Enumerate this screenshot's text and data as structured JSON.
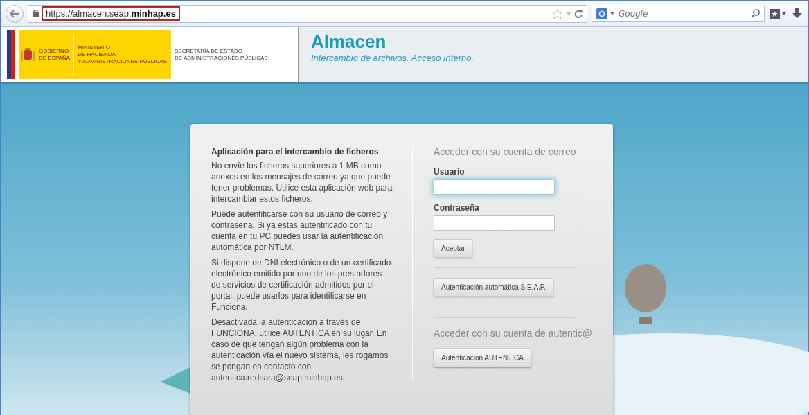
{
  "browser": {
    "url": "https://almacen.seap.**minhap.es**",
    "search": {
      "placeholder": "Google"
    }
  },
  "header": {
    "logo": {
      "gov": [
        "GOBIERNO",
        "DE ESPAÑA"
      ],
      "ministry": [
        "MINISTERIO",
        "DE HACIENDA",
        "Y ADMINISTRACIONES PÚBLICAS"
      ],
      "secretary": [
        "SECRETARÍA DE ESTADO",
        "DE ADMINISTRACIONES PÚBLICAS"
      ]
    },
    "title": "Almacen",
    "subtitle": "Intercambio de archivos. Acceso Interno."
  },
  "info": {
    "heading": "Aplicación para el intercambio de ficheros",
    "paragraphs": [
      "No envíe los ficheros superiores a 1 MB como anexos en los mensajes de correo ya que puede tener problemas. Utilice esta aplicación web para intercambiar estos ficheros.",
      "Puede autentificarse con su usuario de correo y contraseña. Si ya estas autentificado con tu cuenta en tu PC puedes usar la autentificación automática por NTLM.",
      "Si dispone de DNI electrónico o de un certificado electrónico emitido por uno de los prestadores de servicios de certificación admitidos por el portal, puede usarlos para identificarse en Funciona.",
      "Desactivada la autenticación a través de FUNCIONA, utilice AUTENTICA en su lugar. En caso de que tengan algún problema con la autenticación vía el nuevo sistema, les rogamos se pongan en contacto con autentica.redsara@seap.minhap.es."
    ]
  },
  "login": {
    "heading": "Acceder con su cuenta de correo",
    "fields": [
      {
        "label": "Usuario",
        "focused": true
      },
      {
        "label": "Contraseña",
        "focused": false
      }
    ],
    "submit": "Aceptar",
    "auto_button": "Autenticación automática S.E.A.P.",
    "autentica_heading": "Acceder con su cuenta de autentic@",
    "autentica_button": "Autenticación AUTENTICA"
  }
}
